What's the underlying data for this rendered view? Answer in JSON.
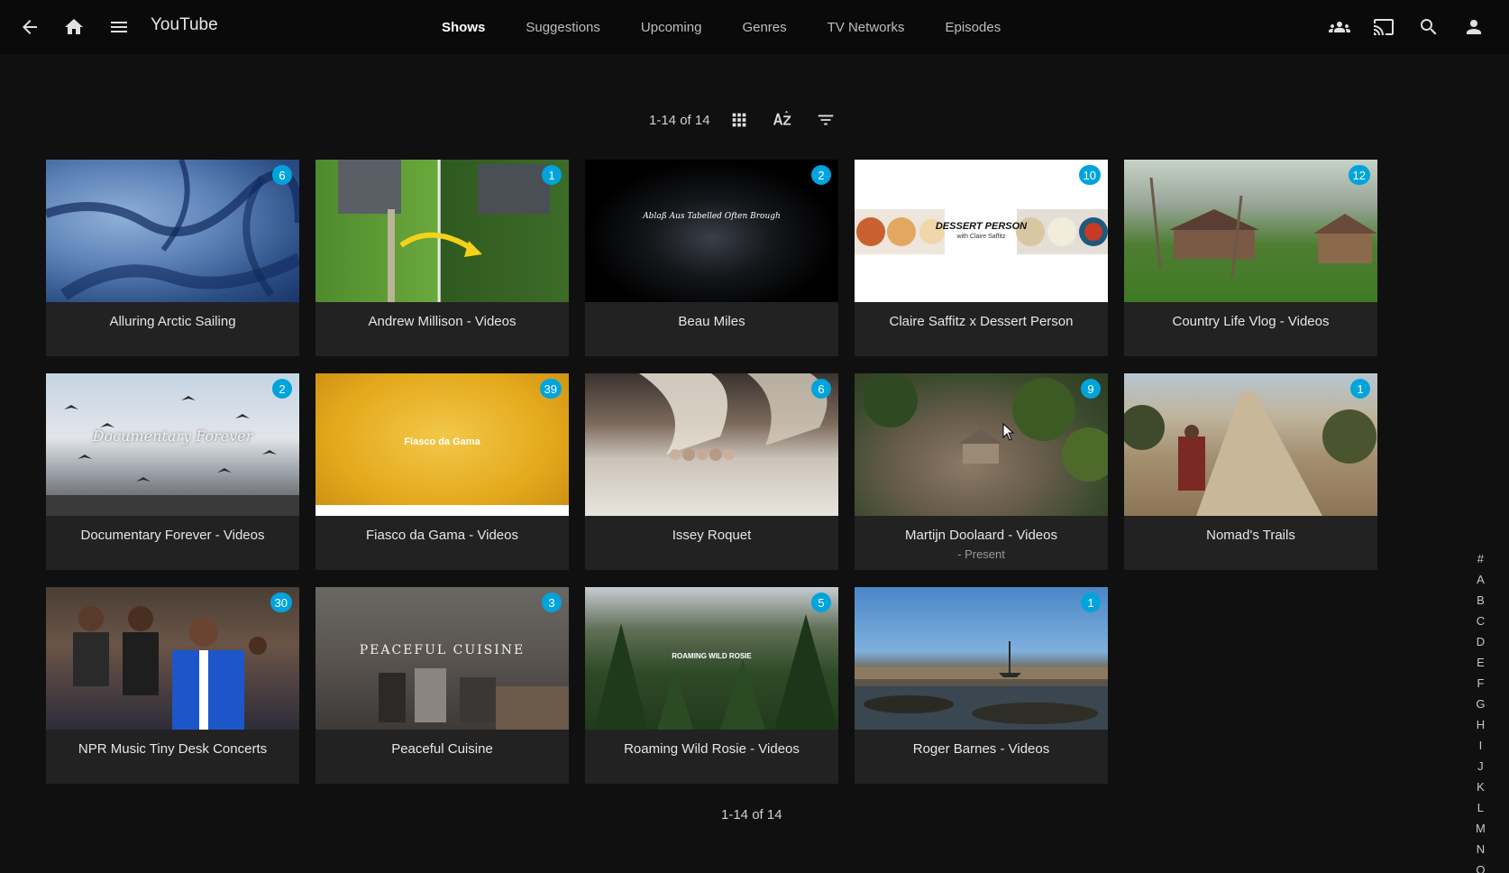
{
  "header": {
    "app_title": "YouTube",
    "tabs": [
      {
        "label": "Shows",
        "active": true
      },
      {
        "label": "Suggestions",
        "active": false
      },
      {
        "label": "Upcoming",
        "active": false
      },
      {
        "label": "Genres",
        "active": false
      },
      {
        "label": "TV Networks",
        "active": false
      },
      {
        "label": "Episodes",
        "active": false
      }
    ],
    "icons": [
      "back-arrow-icon",
      "home-icon",
      "menu-icon",
      "group-icon",
      "cast-icon",
      "search-icon",
      "user-icon"
    ]
  },
  "toolbar": {
    "count": "1-14 of 14",
    "icons": [
      "grid-view-icon",
      "sort-az-icon",
      "filter-icon"
    ]
  },
  "shows": [
    {
      "title": "Alluring Arctic Sailing",
      "badge": "6",
      "subtitle": ""
    },
    {
      "title": "Andrew Millison - Videos",
      "badge": "1",
      "subtitle": ""
    },
    {
      "title": "Beau Miles",
      "badge": "2",
      "subtitle": "",
      "thumb_text": "Ablaß Aus Tabelled Often Brough"
    },
    {
      "title": "Claire Saffitz x Dessert Person",
      "badge": "10",
      "subtitle": "",
      "thumb_text": "DESSERT PERSON",
      "thumb_subtext": "with Claire Saffitz"
    },
    {
      "title": "Country Life Vlog - Videos",
      "badge": "12",
      "subtitle": ""
    },
    {
      "title": "Documentary Forever - Videos",
      "badge": "2",
      "subtitle": "",
      "thumb_text": "Documentary Forever"
    },
    {
      "title": "Fiasco da Gama - Videos",
      "badge": "39",
      "subtitle": "",
      "thumb_text": "Fiasco da Gama"
    },
    {
      "title": "Issey Roquet",
      "badge": "6",
      "subtitle": ""
    },
    {
      "title": "Martijn Doolaard - Videos",
      "badge": "9",
      "subtitle": "- Present"
    },
    {
      "title": "Nomad's Trails",
      "badge": "1",
      "subtitle": ""
    },
    {
      "title": "NPR Music Tiny Desk Concerts",
      "badge": "30",
      "subtitle": ""
    },
    {
      "title": "Peaceful Cuisine",
      "badge": "3",
      "subtitle": "",
      "thumb_text": "PEACEFUL CUISINE"
    },
    {
      "title": "Roaming Wild Rosie - Videos",
      "badge": "5",
      "subtitle": "",
      "thumb_text": "ROAMING WILD ROSIE"
    },
    {
      "title": "Roger Barnes - Videos",
      "badge": "1",
      "subtitle": ""
    }
  ],
  "footer": {
    "count": "1-14 of 14"
  },
  "alpha_index": [
    "#",
    "A",
    "B",
    "C",
    "D",
    "E",
    "F",
    "G",
    "H",
    "I",
    "J",
    "K",
    "L",
    "M",
    "N",
    "O"
  ],
  "colors": {
    "accent": "#00a4dc",
    "background": "#101010",
    "card": "#222222"
  }
}
